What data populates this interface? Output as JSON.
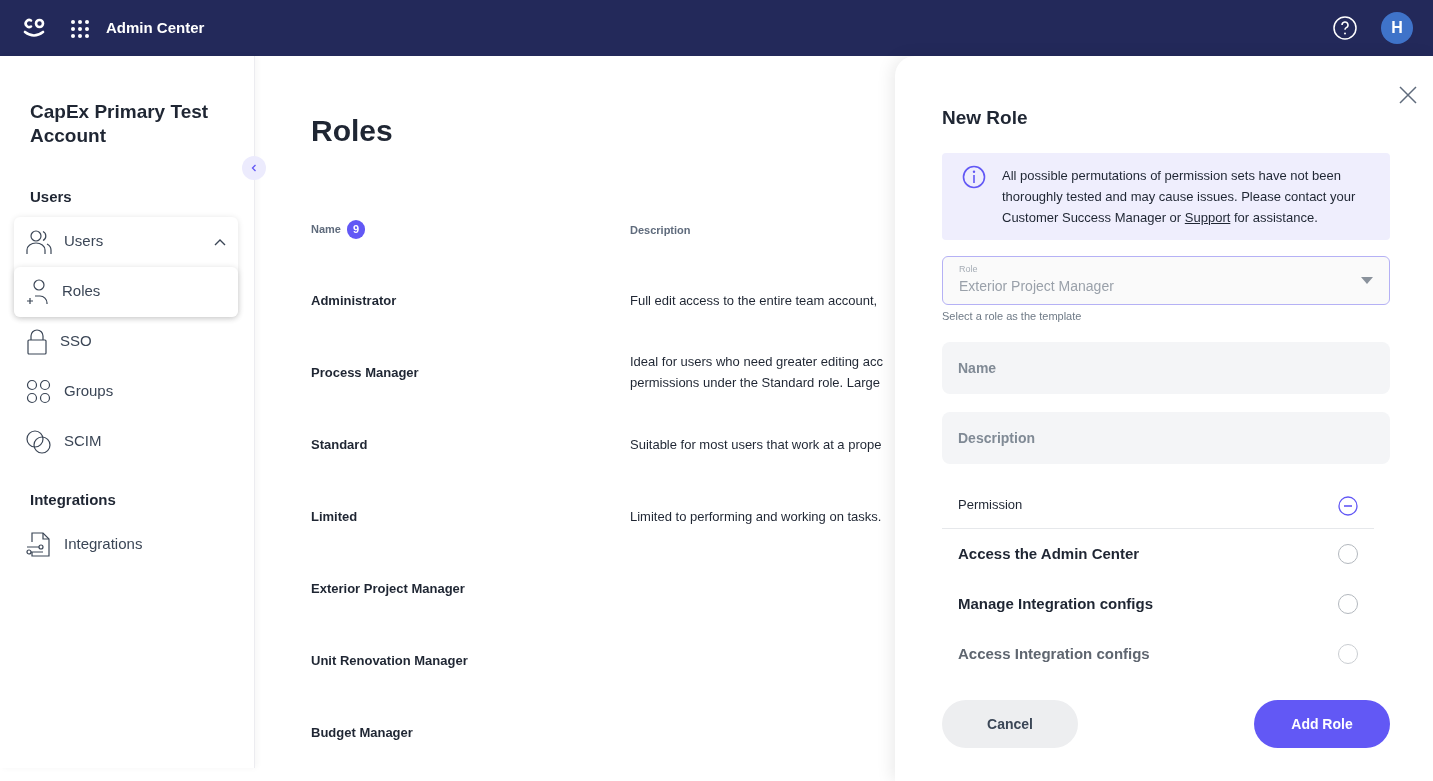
{
  "topbar": {
    "title": "Admin Center",
    "avatar": "H"
  },
  "sidebar": {
    "account": "CapEx Primary Test Account",
    "sections": [
      {
        "title": "Users",
        "items": [
          {
            "label": "Users",
            "expanded": true,
            "selected": false,
            "children": [
              {
                "label": "Roles",
                "selected": true
              }
            ]
          },
          {
            "label": "SSO",
            "selected": false
          },
          {
            "label": "Groups",
            "selected": false
          },
          {
            "label": "SCIM",
            "selected": false
          }
        ]
      },
      {
        "title": "Integrations",
        "items": [
          {
            "label": "Integrations",
            "selected": false
          }
        ]
      }
    ]
  },
  "page": {
    "title": "Roles",
    "columns": [
      {
        "label": "Name",
        "count": "9"
      },
      {
        "label": "Description"
      }
    ],
    "rows": [
      {
        "name": "Administrator",
        "description": [
          "Full edit access to the entire team account,"
        ]
      },
      {
        "name": "Process Manager",
        "description": [
          "Ideal for users who need greater editing acc",
          "permissions under the Standard role. Large"
        ]
      },
      {
        "name": "Standard",
        "description": [
          "Suitable for most users that work at a prope"
        ]
      },
      {
        "name": "Limited",
        "description": [
          "Limited to performing and working on tasks."
        ]
      },
      {
        "name": "Exterior Project Manager",
        "description": []
      },
      {
        "name": "Unit Renovation Manager",
        "description": []
      },
      {
        "name": "Budget Manager",
        "description": []
      }
    ]
  },
  "drawer": {
    "title": "New Role",
    "notice": {
      "before": "All possible permutations of permission sets have not been thoroughly tested and may cause issues. Please contact your Customer Success Manager or",
      "link": "Support",
      "after": "for assistance."
    },
    "role_select": {
      "label": "Role",
      "value": "Exterior Project Manager",
      "hint": "Select a role as the template"
    },
    "name_field": {
      "placeholder": "Name"
    },
    "description_field": {
      "placeholder": "Description"
    },
    "permission_header": "Permission",
    "permissions": [
      {
        "label": "Access the Admin Center",
        "checked": false,
        "disabled": false
      },
      {
        "label": "Manage Integration configs",
        "checked": false,
        "disabled": false
      },
      {
        "label": "Access Integration configs",
        "checked": false,
        "disabled": true
      }
    ],
    "buttons": [
      {
        "label": "Cancel",
        "kind": "secondary"
      },
      {
        "label": "Add Role",
        "kind": "primary"
      }
    ]
  }
}
